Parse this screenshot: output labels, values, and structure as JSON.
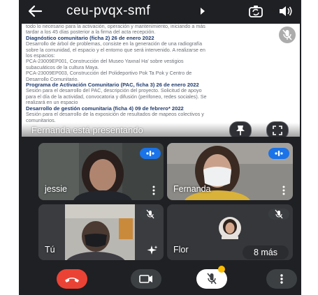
{
  "header": {
    "meeting_code": "ceu-pvqx-smf",
    "icons": [
      "arrow-back-icon",
      "chevron-right-icon",
      "switch-camera-icon",
      "speaker-icon"
    ]
  },
  "presentation": {
    "lines": [
      {
        "text": "todo lo necesario para la activación, operación y mantenimiento, iniciando a más",
        "style": "faint"
      },
      {
        "text": "tardar a los 45 días posterior a la firma del acta recepción.",
        "style": "faint"
      },
      {
        "text": "Diagnóstico comunitario (ficha 2) 26 de enero 2022",
        "style": "h"
      },
      {
        "text": "Desarrollo de árbol de problemas, consiste en la generación de una radiografía",
        "style": "faint"
      },
      {
        "text": "sobre la comunidad, el espacio y el entorno que será intervenido. A realizarse en",
        "style": "faint"
      },
      {
        "text": "los espacios:",
        "style": "faint"
      },
      {
        "text": "PCA-23009EP001, Construcción del Museo Yaxnal Ha' sobre vestigios",
        "style": "faint"
      },
      {
        "text": "subacuáticos de la cultura Maya.",
        "style": "faint"
      },
      {
        "text": "PCA-23009EP003, Construcción del Polideportivo Pok Ta Pok y Centro de",
        "style": "faint"
      },
      {
        "text": "Desarrollo Comunitario.",
        "style": "faint"
      },
      {
        "text": "Programa de Activación Comunitario (PAC, ficha 3) 26 de enero 2022",
        "style": "h"
      },
      {
        "text": "Sesión para el desarrollo del PAC, descripción del proyecto. Solicitud de apoyo",
        "style": "faint"
      },
      {
        "text": "para el día de la actividad, convocatoria y difusión (perifoneo, redes sociales). Se",
        "style": "faint"
      },
      {
        "text": "realizará en un espacio",
        "style": "faint"
      },
      {
        "text": "Desarrollo de gestión comunitaria (ficha 4) 09 de febrero* 2022",
        "style": "h"
      },
      {
        "text": "Sesión para el desarrollo de la exposición de resultados de mapeos colectivos y",
        "style": "faint"
      },
      {
        "text": "comunitarios.",
        "style": "faint"
      }
    ],
    "presenting_label": "Fernanda está presentando",
    "icons": [
      "mic-off-icon",
      "pin-icon",
      "fullscreen-icon"
    ]
  },
  "participants": [
    {
      "name": "jessie",
      "status": "speaking",
      "icons": [
        "audio-level-icon",
        "more-options-icon"
      ]
    },
    {
      "name": "Fernanda",
      "status": "speaking",
      "icons": [
        "audio-level-icon",
        "more-options-icon"
      ]
    },
    {
      "name": "Tú",
      "status": "muted",
      "icons": [
        "mic-off-icon",
        "effects-sparkle-icon"
      ]
    },
    {
      "name": "Flor",
      "status": "muted",
      "icons": [
        "mic-off-icon"
      ]
    }
  ],
  "overflow": {
    "label": "8 más"
  },
  "controls": {
    "icons": [
      "hang-up-icon",
      "camera-icon",
      "mic-off-icon",
      "more-vert-icon"
    ],
    "colors": {
      "hangup": "#ea4335",
      "active_pill": "#1a73e8",
      "notification_badge": "#fbbc04"
    }
  }
}
